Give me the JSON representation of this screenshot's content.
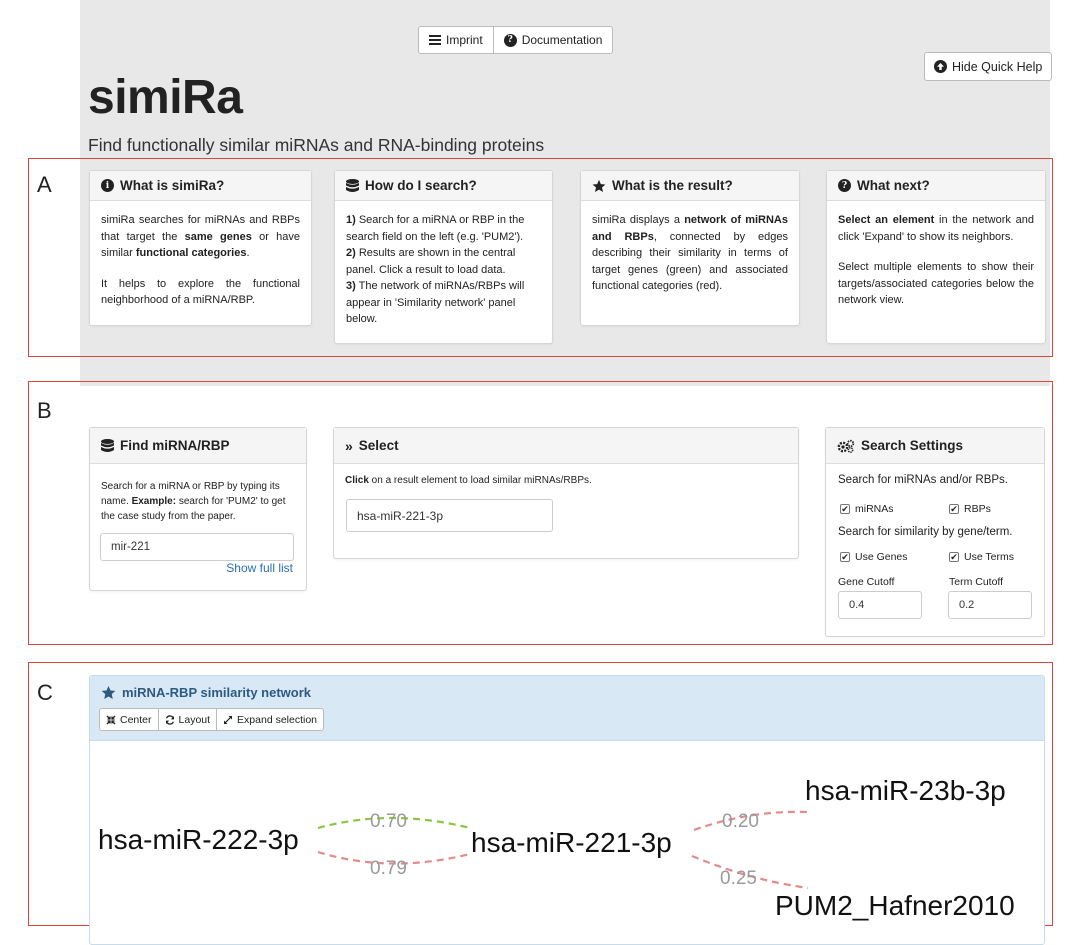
{
  "topnav": {
    "imprint": "Imprint",
    "documentation": "Documentation"
  },
  "hide_help": "Hide Quick Help",
  "title": "simiRa",
  "subtitle": "Find functionally similar miRNAs and RNA-binding proteins",
  "sections": {
    "a": "A",
    "b": "B",
    "c": "C"
  },
  "help": {
    "what_is": {
      "title": "What is simiRa?",
      "p1": [
        "simiRa searches for miRNAs and RBPs that target the ",
        "same genes",
        " or have similar ",
        "functional categories",
        "."
      ],
      "p2": "It helps to explore the functional neighborhood of a miRNA/RBP."
    },
    "how": {
      "title": "How do I search?",
      "steps": [
        {
          "num": "1)",
          "text": " Search for a miRNA or RBP in the search field on the left (e.g. 'PUM2')."
        },
        {
          "num": "2)",
          "text": " Results are shown in the central panel. Click a result to load data."
        },
        {
          "num": "3)",
          "text": " The network of miRNAs/RBPs will appear in 'Similarity network' panel below."
        }
      ]
    },
    "result": {
      "title": "What is the result?",
      "parts": [
        "simiRa displays a ",
        "network of miRNAs and RBPs",
        ", connected by edges describing their similarity in terms of target genes (green) and associated functional categories (red)."
      ]
    },
    "next": {
      "title": "What next?",
      "p1": [
        "Select an element",
        " in the network and click 'Expand' to show its neighbors."
      ],
      "p2": "Select multiple elements to show their targets/associated categories below the network view."
    }
  },
  "find": {
    "title": "Find miRNA/RBP",
    "desc": [
      "Search for a miRNA or RBP by typing its name. ",
      "Example:",
      " search for 'PUM2' to get the case study from the paper."
    ],
    "input_value": "mir-221",
    "show_full": "Show full list"
  },
  "select": {
    "title": "Select",
    "desc": [
      "Click",
      " on a result element to load similar miRNAs/RBPs."
    ],
    "result": "hsa-miR-221-3p"
  },
  "settings": {
    "title": "Search Settings",
    "search_for": "Search for miRNAs and/or RBPs.",
    "mirnas": "miRNAs",
    "rbps": "RBPs",
    "similarity_by": "Search for similarity by gene/term.",
    "use_genes": "Use Genes",
    "use_terms": "Use Terms",
    "gene_cutoff_label": "Gene Cutoff",
    "gene_cutoff": "0.4",
    "term_cutoff_label": "Term Cutoff",
    "term_cutoff": "0.2"
  },
  "network": {
    "title": "miRNA-RBP similarity network",
    "toolbar": {
      "center": "Center",
      "layout": "Layout",
      "expand": "Expand selection"
    },
    "nodes": {
      "n222": "hsa-miR-222-3p",
      "n221": "hsa-miR-221-3p",
      "n23b": "hsa-miR-23b-3p",
      "pum2": "PUM2_Hafner2010"
    },
    "edges": {
      "e_green": "0.70",
      "e_red_222": "0.79",
      "e_red_23b": "0.20",
      "e_red_pum2": "0.25"
    },
    "colors": {
      "gene_edge": "#8cc63f",
      "term_edge": "#e58a8a"
    }
  }
}
